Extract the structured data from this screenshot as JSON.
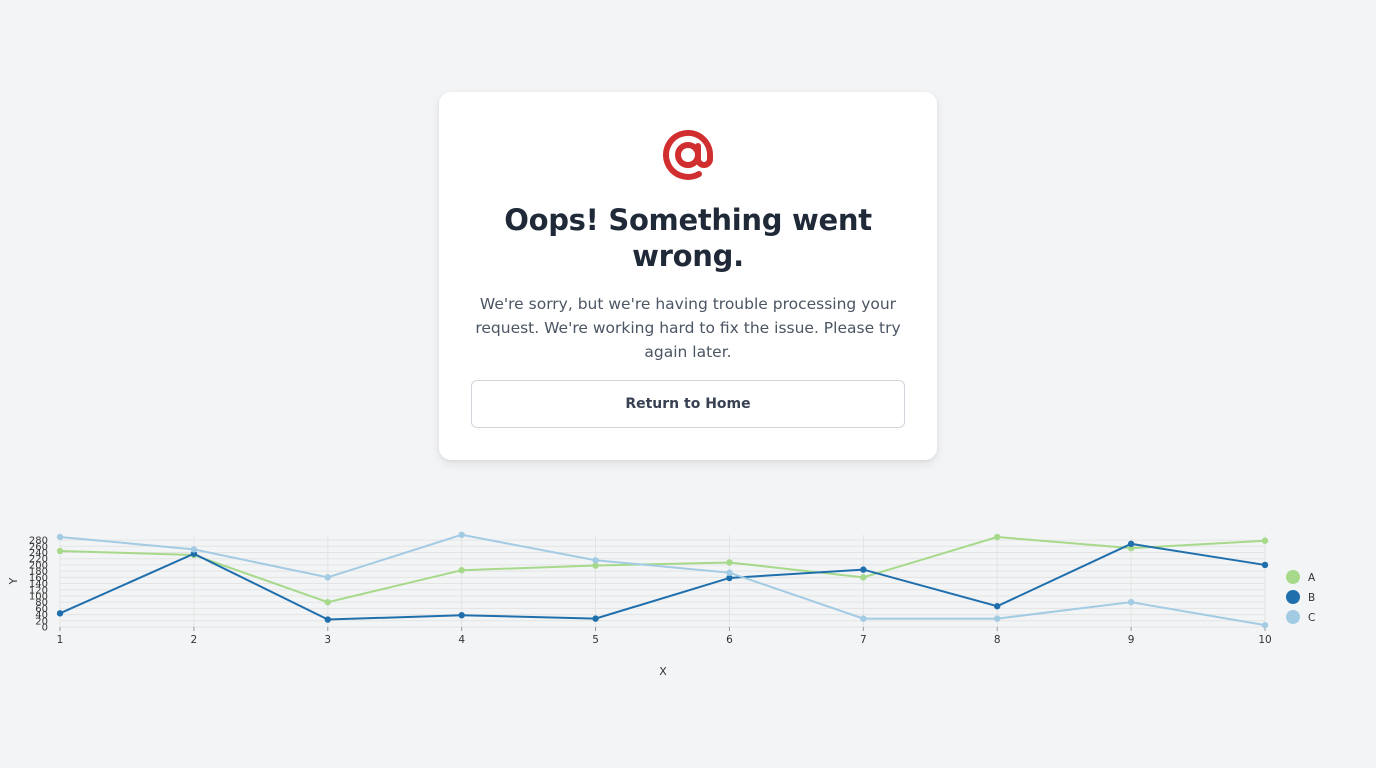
{
  "error": {
    "title": "Oops! Something went wrong.",
    "message": "We're sorry, but we're having trouble processing your request. We're working hard to fix the issue. Please try again later.",
    "button_label": "Return to Home",
    "icon": "at-sign-icon",
    "icon_color": "#d12f2f"
  },
  "chart_data": {
    "type": "line",
    "title": "",
    "xlabel": "X",
    "ylabel": "Y",
    "x": [
      1,
      2,
      3,
      4,
      5,
      6,
      7,
      8,
      9,
      10
    ],
    "ylim": [
      0,
      290
    ],
    "yticks": [
      0,
      20,
      40,
      60,
      80,
      100,
      120,
      140,
      160,
      180,
      200,
      220,
      240,
      260,
      280
    ],
    "grid": true,
    "legend_position": "right",
    "series": [
      {
        "name": "A",
        "color": "#a6d98a",
        "values": [
          245,
          232,
          80,
          183,
          198,
          208,
          160,
          290,
          254,
          278
        ]
      },
      {
        "name": "B",
        "color": "#1f6fad",
        "values": [
          44,
          236,
          24,
          38,
          27,
          158,
          185,
          67,
          268,
          200
        ]
      },
      {
        "name": "C",
        "color": "#a3cbe3",
        "values": [
          290,
          250,
          160,
          297,
          215,
          175,
          27,
          27,
          80,
          6
        ]
      }
    ]
  }
}
